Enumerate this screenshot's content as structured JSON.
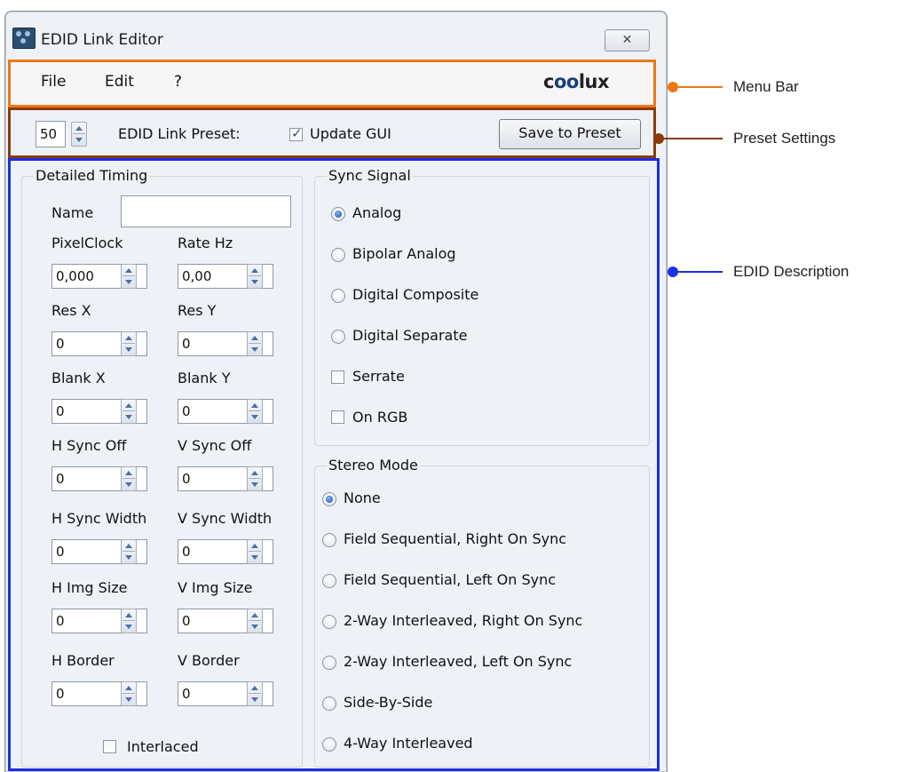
{
  "window": {
    "title": "EDID Link Editor",
    "close_glyph": "✕"
  },
  "menu": {
    "items": [
      "File",
      "Edit",
      "?"
    ],
    "logo_text_pre": "c",
    "logo_text_oo": "oo",
    "logo_text_post": "lux"
  },
  "preset": {
    "number": "50",
    "preset_label": "EDID Link Preset:",
    "update_gui_label": "Update GUI",
    "update_gui_checked": true,
    "save_button": "Save to Preset"
  },
  "timing": {
    "group_title": "Detailed Timing",
    "name_label": "Name",
    "name_value": "",
    "fields": [
      {
        "label": "PixelClock",
        "value": "0,000"
      },
      {
        "label": "Rate Hz",
        "value": "0,00"
      },
      {
        "label": "Res X",
        "value": "0"
      },
      {
        "label": "Res Y",
        "value": "0"
      },
      {
        "label": "Blank X",
        "value": "0"
      },
      {
        "label": "Blank Y",
        "value": "0"
      },
      {
        "label": "H Sync Off",
        "value": "0"
      },
      {
        "label": "V Sync Off",
        "value": "0"
      },
      {
        "label": "H Sync Width",
        "value": "0"
      },
      {
        "label": "V Sync Width",
        "value": "0"
      },
      {
        "label": "H Img Size",
        "value": "0"
      },
      {
        "label": "V Img Size",
        "value": "0"
      },
      {
        "label": "H Border",
        "value": "0"
      },
      {
        "label": "V Border",
        "value": "0"
      }
    ],
    "interlaced_label": "Interlaced",
    "interlaced_checked": false
  },
  "sync": {
    "group_title": "Sync Signal",
    "options": [
      "Analog",
      "Bipolar Analog",
      "Digital Composite",
      "Digital Separate"
    ],
    "selected": "Analog",
    "serrate_label": "Serrate",
    "serrate_checked": false,
    "onrgb_label": "On RGB",
    "onrgb_checked": false
  },
  "stereo": {
    "group_title": "Stereo Mode",
    "options": [
      "None",
      "Field Sequential, Right On Sync",
      "Field Sequential, Left On Sync",
      "2-Way Interleaved, Right On Sync",
      "2-Way Interleaved, Left On Sync",
      "Side-By-Side",
      "4-Way Interleaved"
    ],
    "selected": "None"
  },
  "annotations": {
    "menu_bar": "Menu Bar",
    "preset_settings": "Preset Settings",
    "edid_description": "EDID Description",
    "colors": {
      "menu_bar": "#ef7716",
      "preset_settings": "#8b3a0b",
      "edid_description": "#1b2fe3"
    }
  }
}
